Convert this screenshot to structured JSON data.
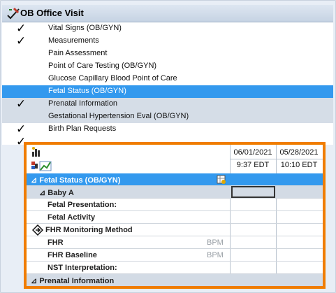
{
  "window": {
    "title": "OB Office Visit"
  },
  "checklist": [
    {
      "label": "Vital Signs (OB/GYN)",
      "checked": true,
      "state": "normal"
    },
    {
      "label": "Measurements",
      "checked": true,
      "state": "normal"
    },
    {
      "label": "Pain Assessment",
      "checked": false,
      "state": "normal"
    },
    {
      "label": "Point of Care Testing (OB/GYN)",
      "checked": false,
      "state": "normal"
    },
    {
      "label": "Glucose Capillary Blood Point of Care",
      "checked": false,
      "state": "normal"
    },
    {
      "label": "Fetal Status (OB/GYN)",
      "checked": false,
      "state": "selected"
    },
    {
      "label": "Prenatal Information",
      "checked": true,
      "state": "shaded"
    },
    {
      "label": "Gestational Hypertension Eval (OB/GYN)",
      "checked": false,
      "state": "shaded"
    },
    {
      "label": "Birth Plan Requests",
      "checked": true,
      "state": "normal"
    }
  ],
  "grid": {
    "columns": [
      {
        "date": "06/01/2021",
        "time": "9:37 EDT"
      },
      {
        "date": "05/28/2021",
        "time": "10:10 EDT"
      }
    ],
    "rows": [
      {
        "label": "⊿ Fetal Status (OB/GYN)",
        "kind": "section",
        "unit": ""
      },
      {
        "label": "⊿ Baby A",
        "kind": "sub",
        "unit": ""
      },
      {
        "label": "Fetal Presentation:",
        "kind": "field",
        "unit": ""
      },
      {
        "label": "Fetal Activity",
        "kind": "field",
        "unit": ""
      },
      {
        "label": "FHR Monitoring Method",
        "kind": "field-icon",
        "unit": ""
      },
      {
        "label": "FHR",
        "kind": "field",
        "unit": "BPM"
      },
      {
        "label": "FHR Baseline",
        "kind": "field",
        "unit": "BPM"
      },
      {
        "label": "NST Interpretation:",
        "kind": "field",
        "unit": ""
      },
      {
        "label": "⊿ Prenatal Information",
        "kind": "section2",
        "unit": ""
      }
    ]
  },
  "colors": {
    "accent_selection": "#3399ee",
    "highlight_border": "#f07d00"
  }
}
